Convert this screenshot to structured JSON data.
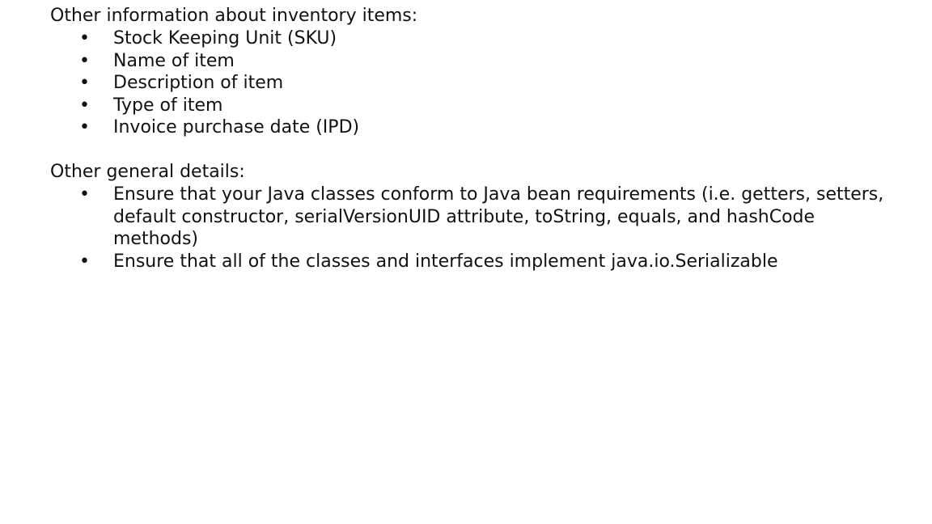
{
  "sections": [
    {
      "heading": "Other information about inventory items:",
      "items": [
        "Stock Keeping Unit (SKU)",
        "Name of item",
        "Description of item",
        "Type of item",
        "Invoice purchase date (IPD)"
      ]
    },
    {
      "heading": "Other general details:",
      "items": [
        "Ensure that your Java classes conform to Java bean requirements (i.e. getters, setters, default constructor, serialVersionUID attribute, toString, equals, and hashCode methods)",
        "Ensure that all of the classes and interfaces implement java.io.Serializable"
      ]
    }
  ],
  "bullet_glyph": "•"
}
